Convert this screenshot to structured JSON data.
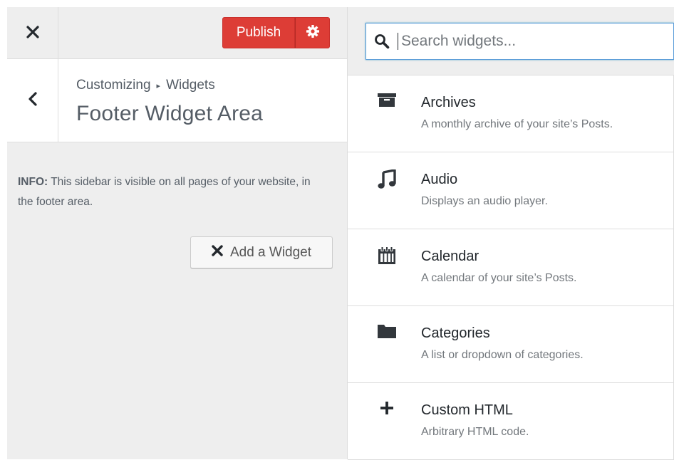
{
  "topbar": {
    "close_label": "Close",
    "publish_label": "Publish",
    "settings_label": "Publish Settings"
  },
  "section": {
    "breadcrumb_parent": "Customizing",
    "breadcrumb_current": "Widgets",
    "title": "Footer Widget Area"
  },
  "info": {
    "label": "INFO:",
    "text": "This sidebar is visible on all pages of your website, in the footer area."
  },
  "add_widget": {
    "label": "Add a Widget"
  },
  "search": {
    "placeholder": "Search widgets...",
    "value": ""
  },
  "widgets": [
    {
      "icon": "archive-icon",
      "title": "Archives",
      "description": "A monthly archive of your site’s Posts."
    },
    {
      "icon": "audio-icon",
      "title": "Audio",
      "description": "Displays an audio player."
    },
    {
      "icon": "calendar-icon",
      "title": "Calendar",
      "description": "A calendar of your site’s Posts."
    },
    {
      "icon": "category-icon",
      "title": "Categories",
      "description": "A list or dropdown of categories."
    },
    {
      "icon": "plus-icon",
      "title": "Custom HTML",
      "description": "Arbitrary HTML code."
    }
  ],
  "colors": {
    "publish": "#dd3d36",
    "panel_bg": "#eeeeee",
    "focus_border": "#5b9dd9",
    "text_dark": "#23282d",
    "text_muted": "#72777c"
  }
}
